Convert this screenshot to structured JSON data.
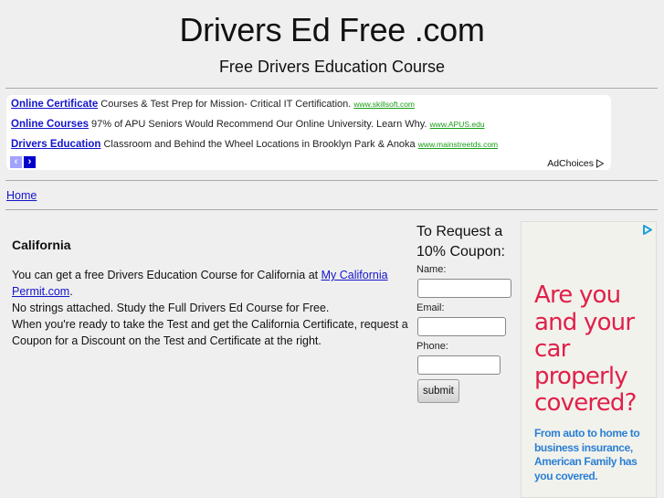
{
  "header": {
    "title": "Drivers Ed Free .com",
    "subtitle": "Free Drivers Education Course"
  },
  "ad_unit": {
    "ads": [
      {
        "title": "Online Certificate",
        "text": " Courses & Test Prep for Mission- Critical IT Certification. ",
        "url": "www.skillsoft.com"
      },
      {
        "title": "Online Courses",
        "text": " 97% of APU Seniors Would Recommend Our Online University. Learn Why. ",
        "url": "www.APUS.edu"
      },
      {
        "title": "Drivers Education",
        "text": " Classroom and Behind the Wheel Locations in Brooklyn Park & Anoka ",
        "url": "www.mainstreetds.com"
      }
    ],
    "prev_icon": "‹",
    "next_icon": "›",
    "adchoices_label": "AdChoices"
  },
  "breadcrumb": {
    "home_label": "Home"
  },
  "content": {
    "heading": "California",
    "para1_before": "You can get a free Drivers Education Course for California at ",
    "para1_link": "My California Permit.com",
    "para1_after": ".",
    "line2": "No strings attached. Study the Full Drivers Ed Course for Free.",
    "line3": "When you're ready to take the Test and get the California Certificate, request a Coupon for a Discount on the Test and Certificate at the right."
  },
  "coupon_form": {
    "heading": "To Request a 10% Coupon:",
    "name_label": "Name:",
    "name_value": "",
    "email_label": "Email:",
    "email_value": "",
    "phone_label": "Phone:",
    "phone_value": "",
    "submit_label": "submit"
  },
  "side_ad": {
    "headline": "Are you and your car properly covered?",
    "body": "From auto to home to business insurance, American Family has you covered.",
    "headline_color": "#e0204a",
    "body_color": "#2b7fd4"
  }
}
